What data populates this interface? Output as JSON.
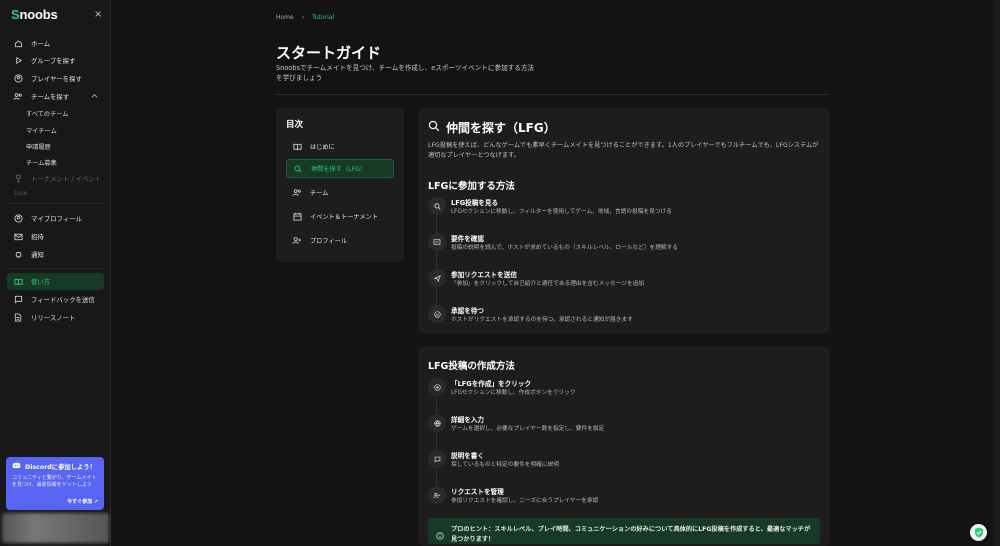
{
  "sidebar": {
    "logo_first": "S",
    "logo_rest": "noobs",
    "close": "×",
    "items": [
      {
        "label": "ホーム"
      },
      {
        "label": "グループを探す"
      },
      {
        "label": "プレイヤーを探す"
      },
      {
        "label": "チームを探す"
      }
    ],
    "sub_items": [
      {
        "label": "すべてのチーム"
      },
      {
        "label": "マイチーム"
      },
      {
        "label": "申請履歴"
      },
      {
        "label": "チーム募集"
      }
    ],
    "tournament": "トーナメント / イベント",
    "soon": "SOON",
    "account_items": [
      {
        "label": "マイプロフィール"
      },
      {
        "label": "招待"
      },
      {
        "label": "通知"
      }
    ],
    "help_items": [
      {
        "label": "使い方"
      },
      {
        "label": "フィードバックを送信"
      },
      {
        "label": "リリースノート"
      }
    ],
    "discord": {
      "title": "Discordに参加しよう！",
      "desc": "コミュニティと繋がり、チームメイトを見つけ、最新情報をゲットしよう",
      "join": "今すぐ参加 ↗"
    }
  },
  "breadcrumb": {
    "home": "Home",
    "sep": "›",
    "current": "Tutorial"
  },
  "page": {
    "title": "スタートガイド",
    "subtitle": "Snoobsでチームメイトを見つけ、チームを作成し、eスポーツイベントに参加する方法を学びましょう"
  },
  "toc": {
    "heading": "目次",
    "items": [
      {
        "label": "はじめに"
      },
      {
        "label": "仲間を探す（LFG）"
      },
      {
        "label": "チーム"
      },
      {
        "label": "イベント＆トーナメント"
      },
      {
        "label": "プロフィール"
      }
    ]
  },
  "lfg": {
    "title": "仲間を探す（LFG）",
    "desc": "LFG投稿を使えば、どんなゲームでも素早くチームメイトを見つけることができます。1人のプレイヤーでもフルチームでも、LFGシステムが適切なプレイヤーとつなげます。",
    "join_title": "LFGに参加する方法",
    "join_steps": [
      {
        "title": "LFG投稿を見る",
        "desc": "LFGセクションに移動し、フィルターを使用してゲーム、地域、言語の投稿を見つける"
      },
      {
        "title": "要件を確認",
        "desc": "投稿の説明を読んで、ホストが求めているもの（スキルレベル、ロールなど）を理解する"
      },
      {
        "title": "参加リクエストを送信",
        "desc": "「参加」をクリックして自己紹介と適任である理由を含むメッセージを追加"
      },
      {
        "title": "承認を待つ",
        "desc": "ホストがリクエストを承認するのを待つ。承認されると通知が届きます"
      }
    ],
    "create_title": "LFG投稿の作成方法",
    "create_steps": [
      {
        "title": "「LFGを作成」をクリック",
        "desc": "LFGセクションに移動し、作成ボタンをクリック"
      },
      {
        "title": "詳細を入力",
        "desc": "ゲームを選択し、必要なプレイヤー数を指定し、要件を設定"
      },
      {
        "title": "説明を書く",
        "desc": "探しているものと特定の要件を明確に説明"
      },
      {
        "title": "リクエストを管理",
        "desc": "参加リクエストを確認し、ニーズに合うプレイヤーを承認"
      }
    ],
    "tip": "プロのヒント：スキルレベル、プレイ時間、コミュニケーションの好みについて具体的にLFG投稿を作成すると、最適なマッチが見つかります！"
  },
  "colors": {
    "accent": "#2ecc71",
    "bg": "#131313",
    "card": "#1d1d1d",
    "discord": "#5865f2"
  }
}
